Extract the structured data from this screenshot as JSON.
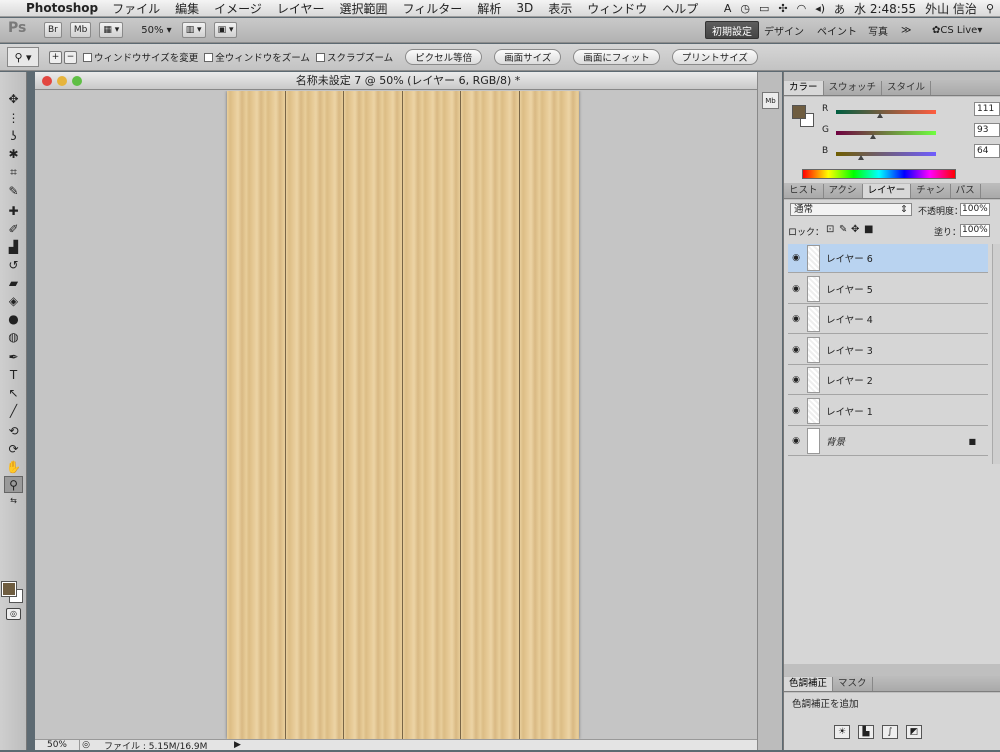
{
  "menubar": {
    "app": "Photoshop",
    "items": [
      "ファイル",
      "編集",
      "イメージ",
      "レイヤー",
      "選択範囲",
      "フィルター",
      "解析",
      "3D",
      "表示",
      "ウィンドウ",
      "ヘルプ"
    ],
    "clock": "水 2:48:55",
    "user": "外山 信治"
  },
  "appbar": {
    "ps": "Ps",
    "br": "Br",
    "mb": "Mb",
    "zoom": "50%",
    "workspaces": [
      "初期設定",
      "デザイン",
      "ペイント",
      "写真"
    ],
    "more": "≫",
    "cslive": "CS Live"
  },
  "options": {
    "checks": [
      "ウィンドウサイズを変更",
      "全ウィンドウをズーム",
      "スクラブズーム"
    ],
    "buttons": [
      "ピクセル等倍",
      "画面サイズ",
      "画面にフィット",
      "プリントサイズ"
    ]
  },
  "document": {
    "title": "名称未設定 7 @ 50% (レイヤー 6, RGB/8) *",
    "zoom": "50%",
    "fileinfo": "ファイル : 5.15M/16.9M"
  },
  "color_panel": {
    "tabs": [
      "カラー",
      "スウォッチ",
      "スタイル"
    ],
    "fg_color": "#6f5d40",
    "sliders": [
      {
        "label": "R",
        "value": "111",
        "level": 0.435
      },
      {
        "label": "G",
        "value": "93",
        "level": 0.365
      },
      {
        "label": "B",
        "value": "64",
        "level": 0.251
      }
    ]
  },
  "layers_panel": {
    "tabs": [
      "ヒスト",
      "アクシ",
      "レイヤー",
      "チャン",
      "パス"
    ],
    "blend_mode": "通常",
    "opacity_label": "不透明度：",
    "opacity": "100%",
    "lock_label": "ロック：",
    "fill_label": "塗り：",
    "fill": "100%",
    "layers": [
      {
        "name": "レイヤー 6",
        "selected": true
      },
      {
        "name": "レイヤー 5"
      },
      {
        "name": "レイヤー 4"
      },
      {
        "name": "レイヤー 3"
      },
      {
        "name": "レイヤー 2"
      },
      {
        "name": "レイヤー 1"
      },
      {
        "name": "背景",
        "locked": true
      }
    ]
  },
  "adjust_panel": {
    "tabs": [
      "色調補正",
      "マスク"
    ],
    "hint": "色調補正を追加"
  }
}
